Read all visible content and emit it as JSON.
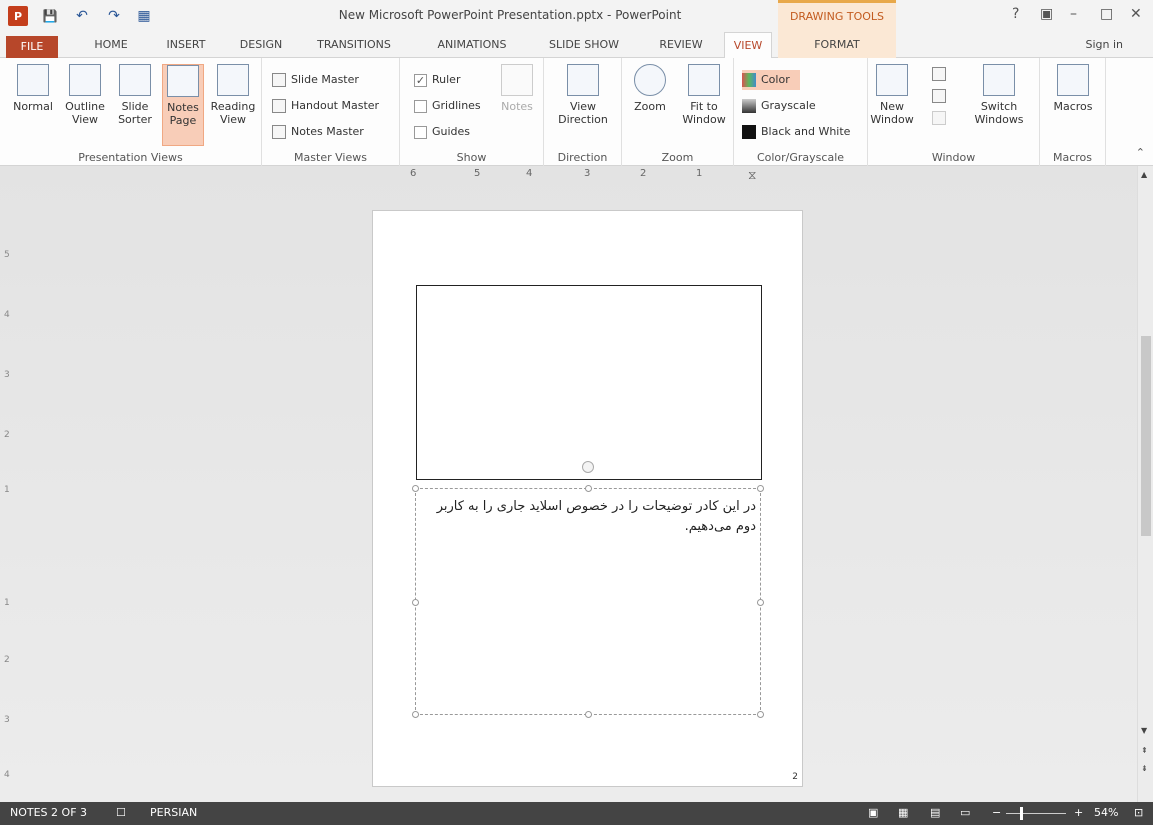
{
  "window": {
    "title": "New Microsoft PowerPoint Presentation.pptx - PowerPoint",
    "contextual_tab": "DRAWING TOOLS",
    "help": "?",
    "controls": [
      "▣",
      "–",
      "□",
      "✕"
    ]
  },
  "qat": {
    "app_icon": "P",
    "save": "💾",
    "undo": "↶",
    "redo": "↷",
    "custom": "▦"
  },
  "tabs": {
    "file": "FILE",
    "home": "HOME",
    "insert": "INSERT",
    "design": "DESIGN",
    "transitions": "TRANSITIONS",
    "animations": "ANIMATIONS",
    "slideshow": "SLIDE SHOW",
    "review": "REVIEW",
    "view": "VIEW",
    "format": "FORMAT",
    "signin": "Sign in"
  },
  "ribbon": {
    "presentation_views": {
      "label": "Presentation Views",
      "normal": "Normal",
      "outline": "Outline View",
      "slide_sorter": "Slide Sorter",
      "notes_page": "Notes Page",
      "reading_view": "Reading View"
    },
    "master_views": {
      "label": "Master Views",
      "slide_master": "Slide Master",
      "handout_master": "Handout Master",
      "notes_master": "Notes Master"
    },
    "show": {
      "label": "Show",
      "ruler": "Ruler",
      "gridlines": "Gridlines",
      "guides": "Guides",
      "notes": "Notes"
    },
    "direction": {
      "label": "Direction",
      "view_direction": "View Direction"
    },
    "zoom": {
      "label": "Zoom",
      "zoom": "Zoom",
      "fit": "Fit to Window"
    },
    "color": {
      "label": "Color/Grayscale",
      "color": "Color",
      "grayscale": "Grayscale",
      "bw": "Black and White"
    },
    "window": {
      "label": "Window",
      "new_window": "New Window",
      "switch": "Switch Windows"
    },
    "macros": {
      "label": "Macros",
      "macros": "Macros"
    }
  },
  "ruler": {
    "marks": [
      "6",
      "5",
      "4",
      "3",
      "2",
      "1"
    ]
  },
  "vruler": {
    "marks": [
      "5",
      "4",
      "3",
      "2",
      "1",
      "1",
      "2",
      "3",
      "4"
    ]
  },
  "page": {
    "notes_text": "در این کادر توضیحات را در خصوص اسلاید جاری را به کاربر دوم می‌دهیم.",
    "page_number": "2"
  },
  "status": {
    "slide": "NOTES 2 OF 3",
    "language": "PERSIAN",
    "zoom": "54%",
    "zoom_level": 0.54
  }
}
